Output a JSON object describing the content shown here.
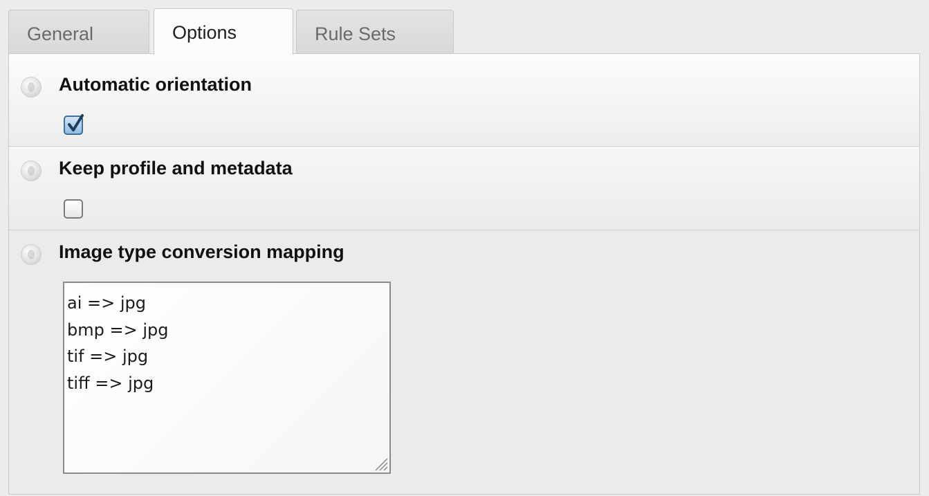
{
  "tabs": [
    {
      "label": "General",
      "active": false
    },
    {
      "label": "Options",
      "active": true
    },
    {
      "label": "Rule Sets",
      "active": false
    }
  ],
  "sections": {
    "auto_orientation": {
      "title": "Automatic orientation",
      "checked": true
    },
    "keep_profile": {
      "title": "Keep profile and metadata",
      "checked": false
    },
    "conversion_mapping": {
      "title": "Image type conversion mapping",
      "lines": [
        "ai => jpg",
        "bmp => jpg",
        "tif => jpg",
        "tiff => jpg"
      ]
    }
  },
  "icons": {
    "help": "help-icon",
    "checkmark": "checkmark-icon",
    "resize_grip": "resize-grip-icon"
  },
  "colors": {
    "checkbox_checked": "#8fbde4",
    "checkmark": "#1d3d5c"
  }
}
